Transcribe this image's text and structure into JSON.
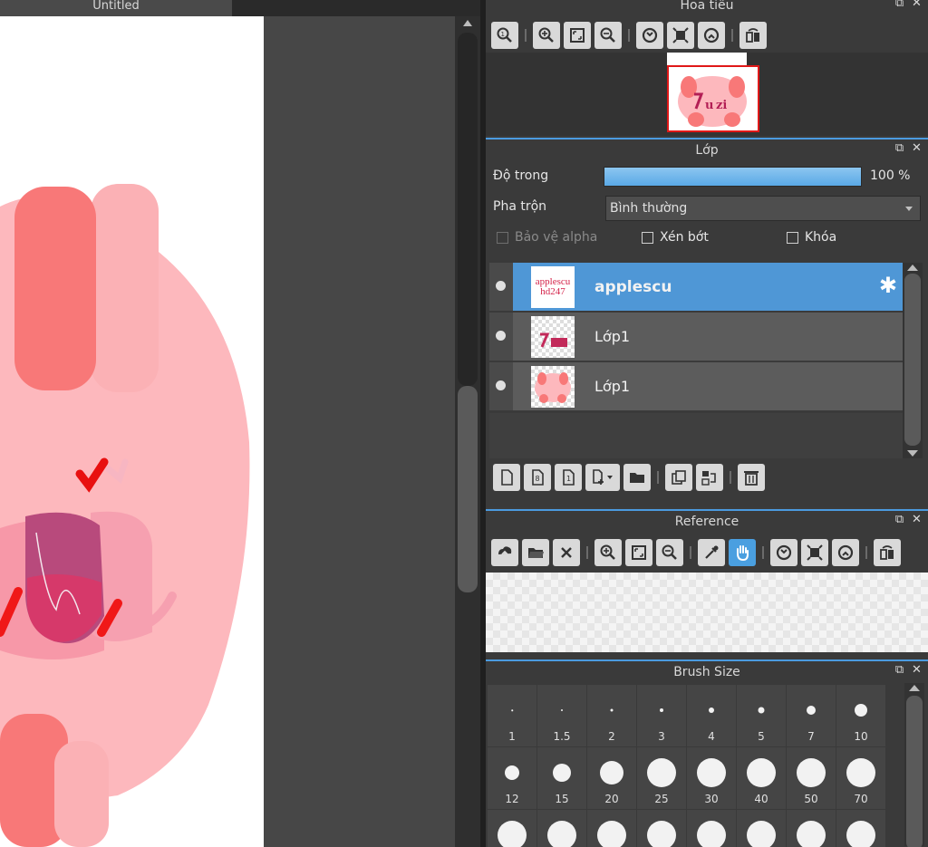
{
  "document": {
    "tab_title": "Untitled"
  },
  "navigator": {
    "title": "Hoa tiêu"
  },
  "layers": {
    "title": "Lớp",
    "opacity_label": "Độ trong",
    "opacity_value": "100 %",
    "opacity_fraction": 1.0,
    "blend_label": "Pha trộn",
    "blend_value": "Bình thường",
    "protect_alpha_label": "Bảo vệ alpha",
    "clipping_label": "Xén bớt",
    "lock_label": "Khóa",
    "items": [
      {
        "name": "applescu",
        "thumb_text": "applescu hd247",
        "selected": true
      },
      {
        "name": "Lớp1",
        "selected": false
      },
      {
        "name": "Lớp1",
        "selected": false
      }
    ]
  },
  "reference": {
    "title": "Reference"
  },
  "brush_size": {
    "title": "Brush Size",
    "sizes": [
      "1",
      "1.5",
      "2",
      "3",
      "4",
      "5",
      "7",
      "10",
      "12",
      "15",
      "20",
      "25",
      "30",
      "40",
      "50",
      "70",
      "",
      "",
      "",
      "",
      "",
      "",
      "",
      ""
    ]
  },
  "icons": {
    "panel_float": "float-window-icon",
    "panel_close": "close-icon",
    "gear": "gear-icon"
  },
  "colors": {
    "accent": "#4f97d6",
    "selection_frame": "#e01818",
    "background": "#3a3a3a"
  }
}
